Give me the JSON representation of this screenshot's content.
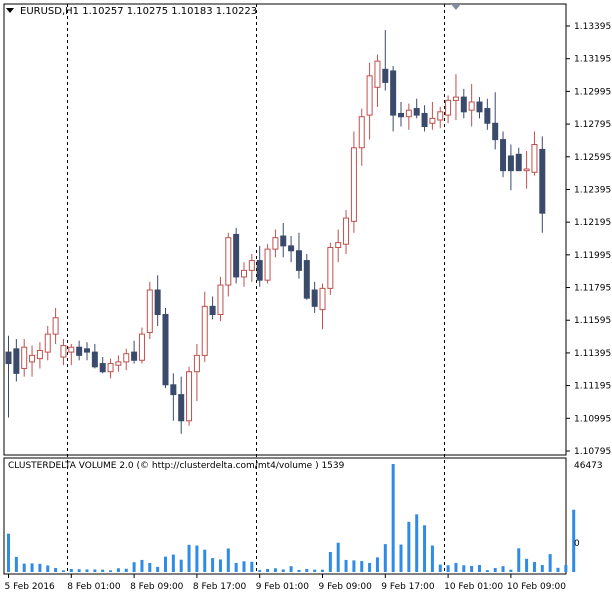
{
  "header": {
    "symbol": "EURUSD,H1",
    "ohlc": "1.10257 1.10275 1.10183 1.10223"
  },
  "indicator": {
    "title": "CLUSTERDELTA VOLUME 2.0 (© http://clusterdelta.com/mt4/volume ) 1539",
    "max_label": "46473",
    "min_label": "0",
    "max_value": 46473
  },
  "price_axis": {
    "labels": [
      "1.13395",
      "1.13195",
      "1.12995",
      "1.12795",
      "1.12595",
      "1.12395",
      "1.12195",
      "1.11995",
      "1.11795",
      "1.11595",
      "1.11395",
      "1.11195",
      "1.10995",
      "1.10795"
    ],
    "min": 1.10795,
    "max": 1.13395
  },
  "time_axis": {
    "labels": [
      "5 Feb 2016",
      "8 Feb 01:00",
      "8 Feb 09:00",
      "8 Feb 17:00",
      "9 Feb 01:00",
      "9 Feb 09:00",
      "9 Feb 17:00",
      "10 Feb 01:00",
      "10 Feb 09:00"
    ],
    "label_bar_index": [
      0,
      8,
      16,
      24,
      32,
      40,
      48,
      56,
      64
    ],
    "separator_bar_index": [
      7.5,
      31.5,
      55.5
    ]
  },
  "colors": {
    "bull": "#c0504d",
    "bear": "#3b4a6b",
    "volume": "#2e8be6",
    "current": "#00aa00",
    "grid": "#000000"
  },
  "chart_data": {
    "type": "candlestick",
    "title": "EURUSD,H1",
    "ylim": [
      1.10795,
      1.13395
    ],
    "candles": [
      {
        "o": 1.114,
        "h": 1.115,
        "l": 1.11,
        "c": 1.1133
      },
      {
        "o": 1.1142,
        "h": 1.1148,
        "l": 1.1122,
        "c": 1.1127
      },
      {
        "o": 1.113,
        "h": 1.1148,
        "l": 1.1125,
        "c": 1.1143
      },
      {
        "o": 1.1134,
        "h": 1.1144,
        "l": 1.1125,
        "c": 1.1138
      },
      {
        "o": 1.1136,
        "h": 1.1146,
        "l": 1.113,
        "c": 1.1141
      },
      {
        "o": 1.114,
        "h": 1.1156,
        "l": 1.1135,
        "c": 1.1151
      },
      {
        "o": 1.1151,
        "h": 1.1167,
        "l": 1.1145,
        "c": 1.1161
      },
      {
        "o": 1.1137,
        "h": 1.1148,
        "l": 1.1132,
        "c": 1.1144
      },
      {
        "o": 1.114,
        "h": 1.1145,
        "l": 1.1132,
        "c": 1.1143
      },
      {
        "o": 1.1143,
        "h": 1.1147,
        "l": 1.1135,
        "c": 1.1138
      },
      {
        "o": 1.1142,
        "h": 1.1146,
        "l": 1.1135,
        "c": 1.114
      },
      {
        "o": 1.114,
        "h": 1.1145,
        "l": 1.113,
        "c": 1.1131
      },
      {
        "o": 1.1133,
        "h": 1.1137,
        "l": 1.1127,
        "c": 1.1128
      },
      {
        "o": 1.1128,
        "h": 1.1136,
        "l": 1.1124,
        "c": 1.1133
      },
      {
        "o": 1.1132,
        "h": 1.1138,
        "l": 1.1128,
        "c": 1.1134
      },
      {
        "o": 1.1134,
        "h": 1.1142,
        "l": 1.1129,
        "c": 1.1139
      },
      {
        "o": 1.114,
        "h": 1.1147,
        "l": 1.1133,
        "c": 1.1135
      },
      {
        "o": 1.1135,
        "h": 1.1155,
        "l": 1.1133,
        "c": 1.1151
      },
      {
        "o": 1.1152,
        "h": 1.1183,
        "l": 1.1148,
        "c": 1.1178
      },
      {
        "o": 1.1178,
        "h": 1.1187,
        "l": 1.1156,
        "c": 1.1163
      },
      {
        "o": 1.1163,
        "h": 1.1167,
        "l": 1.1118,
        "c": 1.112
      },
      {
        "o": 1.112,
        "h": 1.1127,
        "l": 1.1098,
        "c": 1.1114
      },
      {
        "o": 1.1114,
        "h": 1.1125,
        "l": 1.109,
        "c": 1.1098
      },
      {
        "o": 1.1098,
        "h": 1.1131,
        "l": 1.1095,
        "c": 1.1128
      },
      {
        "o": 1.1128,
        "h": 1.1145,
        "l": 1.111,
        "c": 1.1138
      },
      {
        "o": 1.1138,
        "h": 1.1177,
        "l": 1.1134,
        "c": 1.1168
      },
      {
        "o": 1.1168,
        "h": 1.1174,
        "l": 1.116,
        "c": 1.1163
      },
      {
        "o": 1.1163,
        "h": 1.1186,
        "l": 1.1159,
        "c": 1.1181
      },
      {
        "o": 1.1181,
        "h": 1.1213,
        "l": 1.1174,
        "c": 1.121
      },
      {
        "o": 1.1212,
        "h": 1.1216,
        "l": 1.1182,
        "c": 1.1186
      },
      {
        "o": 1.1186,
        "h": 1.1195,
        "l": 1.118,
        "c": 1.119
      },
      {
        "o": 1.119,
        "h": 1.12,
        "l": 1.1183,
        "c": 1.1196
      },
      {
        "o": 1.1196,
        "h": 1.1205,
        "l": 1.118,
        "c": 1.1184
      },
      {
        "o": 1.1184,
        "h": 1.1206,
        "l": 1.1182,
        "c": 1.1203
      },
      {
        "o": 1.1203,
        "h": 1.1215,
        "l": 1.1198,
        "c": 1.121
      },
      {
        "o": 1.1211,
        "h": 1.1219,
        "l": 1.1198,
        "c": 1.1205
      },
      {
        "o": 1.1205,
        "h": 1.1211,
        "l": 1.1195,
        "c": 1.1202
      },
      {
        "o": 1.1202,
        "h": 1.1213,
        "l": 1.1185,
        "c": 1.119
      },
      {
        "o": 1.1196,
        "h": 1.12,
        "l": 1.1172,
        "c": 1.1173
      },
      {
        "o": 1.1178,
        "h": 1.1183,
        "l": 1.1164,
        "c": 1.1168
      },
      {
        "o": 1.1166,
        "h": 1.1182,
        "l": 1.1154,
        "c": 1.1179
      },
      {
        "o": 1.1179,
        "h": 1.1207,
        "l": 1.1175,
        "c": 1.1204
      },
      {
        "o": 1.1204,
        "h": 1.1215,
        "l": 1.1195,
        "c": 1.1207
      },
      {
        "o": 1.1206,
        "h": 1.1227,
        "l": 1.12,
        "c": 1.1222
      },
      {
        "o": 1.122,
        "h": 1.1275,
        "l": 1.1213,
        "c": 1.1265
      },
      {
        "o": 1.1265,
        "h": 1.1289,
        "l": 1.1254,
        "c": 1.1284
      },
      {
        "o": 1.1285,
        "h": 1.1317,
        "l": 1.127,
        "c": 1.1309
      },
      {
        "o": 1.1302,
        "h": 1.1322,
        "l": 1.129,
        "c": 1.1318
      },
      {
        "o": 1.1313,
        "h": 1.1337,
        "l": 1.13,
        "c": 1.1305
      },
      {
        "o": 1.1312,
        "h": 1.1315,
        "l": 1.1275,
        "c": 1.1285
      },
      {
        "o": 1.1286,
        "h": 1.1293,
        "l": 1.1278,
        "c": 1.1284
      },
      {
        "o": 1.1284,
        "h": 1.1292,
        "l": 1.1276,
        "c": 1.1288
      },
      {
        "o": 1.1289,
        "h": 1.1295,
        "l": 1.1283,
        "c": 1.1285
      },
      {
        "o": 1.1286,
        "h": 1.1291,
        "l": 1.1275,
        "c": 1.1278
      },
      {
        "o": 1.128,
        "h": 1.1293,
        "l": 1.1276,
        "c": 1.1283
      },
      {
        "o": 1.1282,
        "h": 1.129,
        "l": 1.1277,
        "c": 1.1287
      },
      {
        "o": 1.1285,
        "h": 1.1297,
        "l": 1.128,
        "c": 1.1294
      },
      {
        "o": 1.1294,
        "h": 1.131,
        "l": 1.1282,
        "c": 1.1296
      },
      {
        "o": 1.1296,
        "h": 1.1301,
        "l": 1.1283,
        "c": 1.1287
      },
      {
        "o": 1.1288,
        "h": 1.1304,
        "l": 1.1278,
        "c": 1.1293
      },
      {
        "o": 1.1293,
        "h": 1.1296,
        "l": 1.1283,
        "c": 1.1287
      },
      {
        "o": 1.1289,
        "h": 1.1295,
        "l": 1.1276,
        "c": 1.128
      },
      {
        "o": 1.128,
        "h": 1.1299,
        "l": 1.1264,
        "c": 1.127
      },
      {
        "o": 1.127,
        "h": 1.1275,
        "l": 1.1247,
        "c": 1.1251
      },
      {
        "o": 1.126,
        "h": 1.1267,
        "l": 1.1239,
        "c": 1.1251
      },
      {
        "o": 1.1261,
        "h": 1.1265,
        "l": 1.1253,
        "c": 1.1251
      },
      {
        "o": 1.1251,
        "h": 1.1263,
        "l": 1.124,
        "c": 1.1252
      },
      {
        "o": 1.125,
        "h": 1.1275,
        "l": 1.1248,
        "c": 1.1267
      },
      {
        "o": 1.1264,
        "h": 1.1272,
        "l": 1.1213,
        "c": 1.1225
      }
    ],
    "volume": [
      16500,
      6500,
      3600,
      3700,
      3500,
      2800,
      1700,
      700,
      1300,
      1200,
      1100,
      1100,
      1000,
      700,
      1600,
      1400,
      4200,
      5200,
      3900,
      2200,
      6600,
      7500,
      5300,
      11700,
      11400,
      9600,
      6000,
      5400,
      10100,
      3900,
      4600,
      4400,
      800,
      1300,
      1600,
      1100,
      2500,
      900,
      1300,
      1000,
      1000,
      8600,
      12600,
      5200,
      5000,
      4700,
      3900,
      6300,
      12000,
      46473,
      11800,
      21600,
      24800,
      20100,
      11400,
      3200,
      2900,
      3900,
      2900,
      2600,
      3000,
      800,
      1700,
      2500,
      1000,
      10200,
      5700,
      4300,
      3000,
      7700,
      1800,
      3000,
      26800
    ]
  }
}
